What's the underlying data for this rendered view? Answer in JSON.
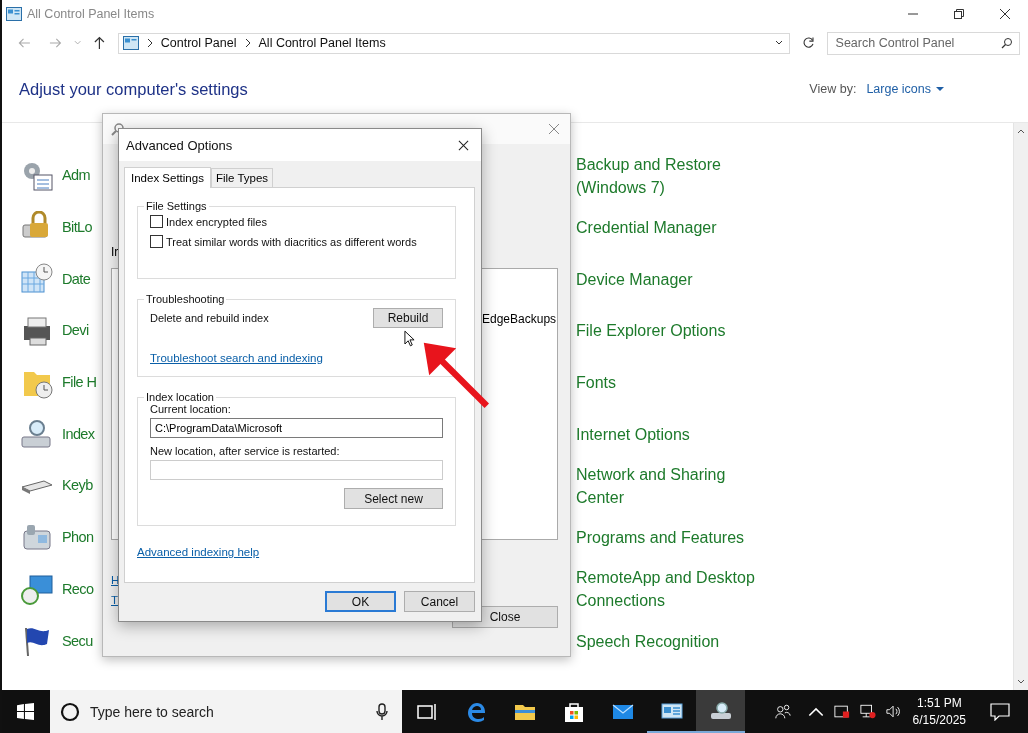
{
  "window": {
    "title": "All Control Panel Items"
  },
  "address": {
    "breadcrumb": [
      "Control Panel",
      "All Control Panel Items"
    ]
  },
  "search": {
    "placeholder": "Search Control Panel"
  },
  "heading": "Adjust your computer's settings",
  "view_by": {
    "label": "View by:",
    "value": "Large icons"
  },
  "items_left": [
    "Adm",
    "BitLo",
    "Date",
    "Devi",
    "File H",
    "Index",
    "Keyb",
    "Phon",
    "Reco",
    "Secu"
  ],
  "items_right": [
    "Backup and Restore (Windows 7)",
    "Credential Manager",
    "Device Manager",
    "File Explorer Options",
    "Fonts",
    "Internet Options",
    "Network and Sharing Center",
    "Programs and Features",
    "RemoteApp and Desktop Connections",
    "Speech Recognition"
  ],
  "indexing_dialog": {
    "partial_label": "Ir",
    "list_item": "EdgeBackups",
    "partial_links": [
      "H",
      "T"
    ],
    "close_button": "Close"
  },
  "advanced_dialog": {
    "title": "Advanced Options",
    "tabs": [
      {
        "label": "Index Settings",
        "selected": true
      },
      {
        "label": "File Types",
        "selected": false
      }
    ],
    "file_settings": {
      "title": "File Settings",
      "options": [
        {
          "label": "Index encrypted files",
          "checked": false
        },
        {
          "label": "Treat similar words with diacritics as different words",
          "checked": false
        }
      ]
    },
    "troubleshooting": {
      "title": "Troubleshooting",
      "text": "Delete and rebuild index",
      "button": "Rebuild",
      "link": "Troubleshoot search and indexing"
    },
    "index_location": {
      "title": "Index location",
      "current_label": "Current location:",
      "current_value": "C:\\ProgramData\\Microsoft",
      "new_label": "New location, after service is restarted:",
      "button": "Select new"
    },
    "help_link": "Advanced indexing help",
    "buttons": [
      {
        "label": "OK",
        "default": true
      },
      {
        "label": "Cancel",
        "default": false
      }
    ]
  },
  "taskbar": {
    "search_placeholder": "Type here to search",
    "apps": [
      {
        "running": false,
        "selected": false
      },
      {
        "running": false,
        "selected": false
      },
      {
        "running": false,
        "selected": false
      },
      {
        "running": false,
        "selected": false
      },
      {
        "running": false,
        "selected": false
      },
      {
        "running": true,
        "selected": false
      },
      {
        "running": true,
        "selected": true
      }
    ],
    "time": "1:51 PM",
    "date": "6/15/2025"
  }
}
